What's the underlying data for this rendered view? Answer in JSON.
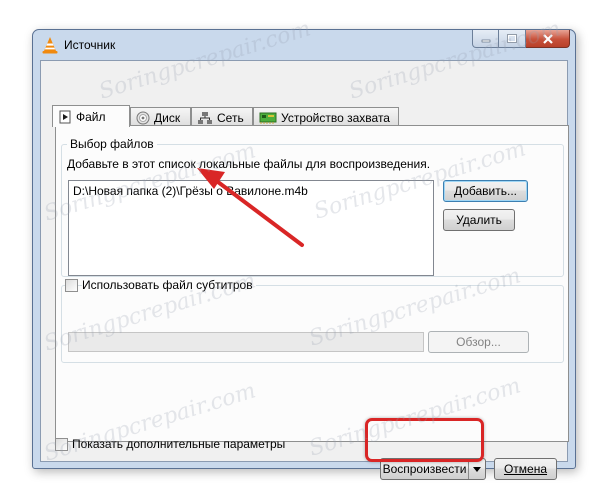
{
  "window": {
    "title": "Источник",
    "accent": "#c9d9ec"
  },
  "tabs": [
    {
      "label": "Файл",
      "icon": "file-icon",
      "active": true
    },
    {
      "label": "Диск",
      "icon": "disc-icon",
      "active": false
    },
    {
      "label": "Сеть",
      "icon": "network-icon",
      "active": false
    },
    {
      "label": "Устройство захвата",
      "icon": "capture-card-icon",
      "active": false
    }
  ],
  "file_section": {
    "title": "Выбор файлов",
    "description": "Добавьте в этот список локальные файлы для воспроизведения.",
    "files": [
      "D:\\Новая папка (2)\\Грёзы о Вавилоне.m4b"
    ],
    "add_label": "Добавить...",
    "remove_label": "Удалить"
  },
  "subtitle_section": {
    "checkbox_label": "Использовать файл субтитров",
    "checked": false,
    "path_value": "",
    "browse_label": "Обзор..."
  },
  "options": {
    "show_more_label": "Показать дополнительные параметры",
    "checked": false
  },
  "footer": {
    "play_label": "Воспроизвести",
    "cancel_label": "Отмена"
  },
  "annotation": {
    "highlight_color": "#d92626"
  },
  "watermark": {
    "text": "Soringpcrepair.com"
  }
}
